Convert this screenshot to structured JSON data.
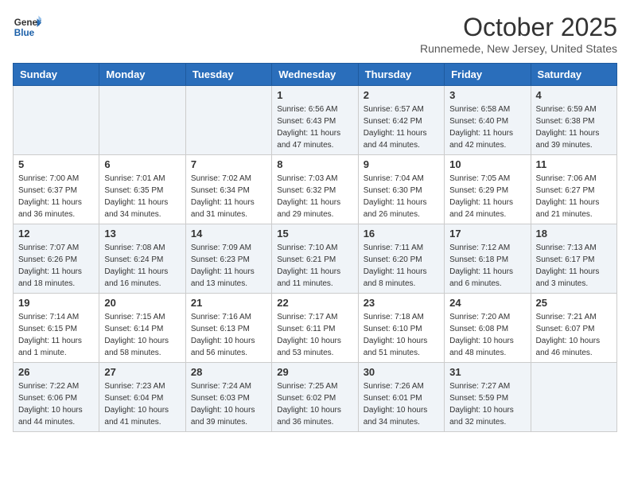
{
  "header": {
    "logo_line1": "General",
    "logo_line2": "Blue",
    "month": "October 2025",
    "location": "Runnemede, New Jersey, United States"
  },
  "weekdays": [
    "Sunday",
    "Monday",
    "Tuesday",
    "Wednesday",
    "Thursday",
    "Friday",
    "Saturday"
  ],
  "weeks": [
    [
      {
        "day": "",
        "info": ""
      },
      {
        "day": "",
        "info": ""
      },
      {
        "day": "",
        "info": ""
      },
      {
        "day": "1",
        "info": "Sunrise: 6:56 AM\nSunset: 6:43 PM\nDaylight: 11 hours\nand 47 minutes."
      },
      {
        "day": "2",
        "info": "Sunrise: 6:57 AM\nSunset: 6:42 PM\nDaylight: 11 hours\nand 44 minutes."
      },
      {
        "day": "3",
        "info": "Sunrise: 6:58 AM\nSunset: 6:40 PM\nDaylight: 11 hours\nand 42 minutes."
      },
      {
        "day": "4",
        "info": "Sunrise: 6:59 AM\nSunset: 6:38 PM\nDaylight: 11 hours\nand 39 minutes."
      }
    ],
    [
      {
        "day": "5",
        "info": "Sunrise: 7:00 AM\nSunset: 6:37 PM\nDaylight: 11 hours\nand 36 minutes."
      },
      {
        "day": "6",
        "info": "Sunrise: 7:01 AM\nSunset: 6:35 PM\nDaylight: 11 hours\nand 34 minutes."
      },
      {
        "day": "7",
        "info": "Sunrise: 7:02 AM\nSunset: 6:34 PM\nDaylight: 11 hours\nand 31 minutes."
      },
      {
        "day": "8",
        "info": "Sunrise: 7:03 AM\nSunset: 6:32 PM\nDaylight: 11 hours\nand 29 minutes."
      },
      {
        "day": "9",
        "info": "Sunrise: 7:04 AM\nSunset: 6:30 PM\nDaylight: 11 hours\nand 26 minutes."
      },
      {
        "day": "10",
        "info": "Sunrise: 7:05 AM\nSunset: 6:29 PM\nDaylight: 11 hours\nand 24 minutes."
      },
      {
        "day": "11",
        "info": "Sunrise: 7:06 AM\nSunset: 6:27 PM\nDaylight: 11 hours\nand 21 minutes."
      }
    ],
    [
      {
        "day": "12",
        "info": "Sunrise: 7:07 AM\nSunset: 6:26 PM\nDaylight: 11 hours\nand 18 minutes."
      },
      {
        "day": "13",
        "info": "Sunrise: 7:08 AM\nSunset: 6:24 PM\nDaylight: 11 hours\nand 16 minutes."
      },
      {
        "day": "14",
        "info": "Sunrise: 7:09 AM\nSunset: 6:23 PM\nDaylight: 11 hours\nand 13 minutes."
      },
      {
        "day": "15",
        "info": "Sunrise: 7:10 AM\nSunset: 6:21 PM\nDaylight: 11 hours\nand 11 minutes."
      },
      {
        "day": "16",
        "info": "Sunrise: 7:11 AM\nSunset: 6:20 PM\nDaylight: 11 hours\nand 8 minutes."
      },
      {
        "day": "17",
        "info": "Sunrise: 7:12 AM\nSunset: 6:18 PM\nDaylight: 11 hours\nand 6 minutes."
      },
      {
        "day": "18",
        "info": "Sunrise: 7:13 AM\nSunset: 6:17 PM\nDaylight: 11 hours\nand 3 minutes."
      }
    ],
    [
      {
        "day": "19",
        "info": "Sunrise: 7:14 AM\nSunset: 6:15 PM\nDaylight: 11 hours\nand 1 minute."
      },
      {
        "day": "20",
        "info": "Sunrise: 7:15 AM\nSunset: 6:14 PM\nDaylight: 10 hours\nand 58 minutes."
      },
      {
        "day": "21",
        "info": "Sunrise: 7:16 AM\nSunset: 6:13 PM\nDaylight: 10 hours\nand 56 minutes."
      },
      {
        "day": "22",
        "info": "Sunrise: 7:17 AM\nSunset: 6:11 PM\nDaylight: 10 hours\nand 53 minutes."
      },
      {
        "day": "23",
        "info": "Sunrise: 7:18 AM\nSunset: 6:10 PM\nDaylight: 10 hours\nand 51 minutes."
      },
      {
        "day": "24",
        "info": "Sunrise: 7:20 AM\nSunset: 6:08 PM\nDaylight: 10 hours\nand 48 minutes."
      },
      {
        "day": "25",
        "info": "Sunrise: 7:21 AM\nSunset: 6:07 PM\nDaylight: 10 hours\nand 46 minutes."
      }
    ],
    [
      {
        "day": "26",
        "info": "Sunrise: 7:22 AM\nSunset: 6:06 PM\nDaylight: 10 hours\nand 44 minutes."
      },
      {
        "day": "27",
        "info": "Sunrise: 7:23 AM\nSunset: 6:04 PM\nDaylight: 10 hours\nand 41 minutes."
      },
      {
        "day": "28",
        "info": "Sunrise: 7:24 AM\nSunset: 6:03 PM\nDaylight: 10 hours\nand 39 minutes."
      },
      {
        "day": "29",
        "info": "Sunrise: 7:25 AM\nSunset: 6:02 PM\nDaylight: 10 hours\nand 36 minutes."
      },
      {
        "day": "30",
        "info": "Sunrise: 7:26 AM\nSunset: 6:01 PM\nDaylight: 10 hours\nand 34 minutes."
      },
      {
        "day": "31",
        "info": "Sunrise: 7:27 AM\nSunset: 5:59 PM\nDaylight: 10 hours\nand 32 minutes."
      },
      {
        "day": "",
        "info": ""
      }
    ]
  ]
}
